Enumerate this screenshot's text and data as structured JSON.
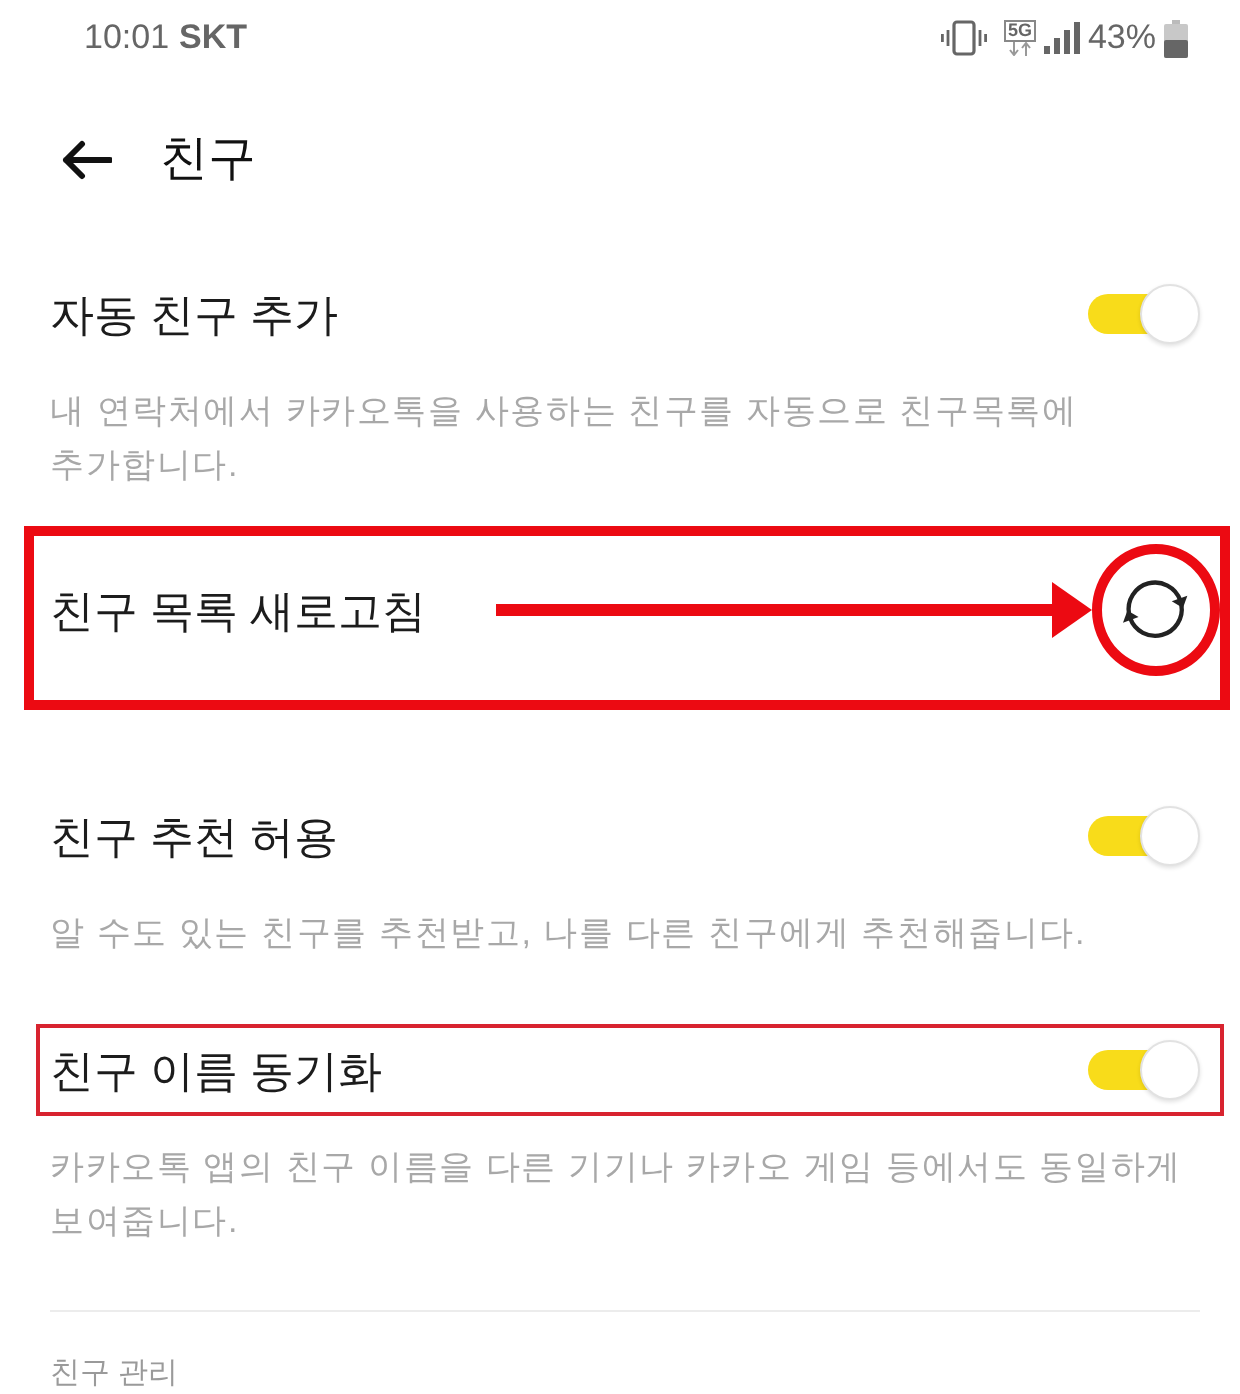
{
  "status_bar": {
    "time": "10:01",
    "carrier": "SKT",
    "network": "5G",
    "battery": "43%"
  },
  "header": {
    "title": "친구"
  },
  "settings": [
    {
      "kind": "toggle",
      "title": "자동 친구 추가",
      "on": true,
      "description": "내 연락처에서 카카오톡을 사용하는 친구를 자동으로 친구목록에 추가합니다."
    },
    {
      "kind": "action",
      "title": "친구 목록 새로고침",
      "framed": true,
      "bold_frame": true,
      "arrow": true,
      "ring": true
    },
    {
      "kind": "toggle",
      "title": "친구 추천 허용",
      "on": true,
      "description": "알 수도 있는 친구를 추천받고, 나를 다른 친구에게 추천해줍니다."
    },
    {
      "kind": "toggle",
      "title": "친구 이름 동기화",
      "on": true,
      "framed": true,
      "bold_frame": false,
      "description": "카카오톡 앱의 친구 이름을 다른 기기나 카카오 게임 등에서도 동일하게 보여줍니다."
    }
  ],
  "section_header": "친구 관리"
}
